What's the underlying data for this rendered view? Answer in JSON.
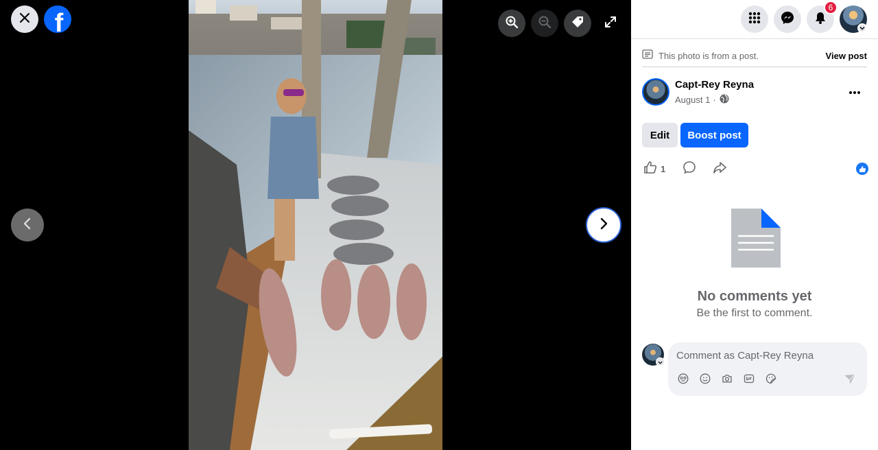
{
  "viewer": {
    "tools": [
      {
        "name": "zoom-in",
        "icon": "zoom-in-icon"
      },
      {
        "name": "zoom-out",
        "icon": "zoom-out-icon"
      },
      {
        "name": "tag",
        "icon": "tag-icon"
      },
      {
        "name": "fullscreen",
        "icon": "expand-icon"
      }
    ],
    "photo_alt": "Photo"
  },
  "topbar": {
    "notifications_count": "6"
  },
  "post": {
    "note": "This photo is from a post.",
    "view_post": "View post",
    "author": "Capt-Rey Reyna",
    "date": "August 1",
    "date_sep": "·",
    "edit_label": "Edit",
    "boost_label": "Boost post",
    "like_count": "1"
  },
  "comments": {
    "empty_title": "No comments yet",
    "empty_sub": "Be the first to comment.",
    "placeholder": "Comment as Capt-Rey Reyna"
  },
  "colors": {
    "accent": "#0866ff",
    "badge": "#e41e3f"
  }
}
